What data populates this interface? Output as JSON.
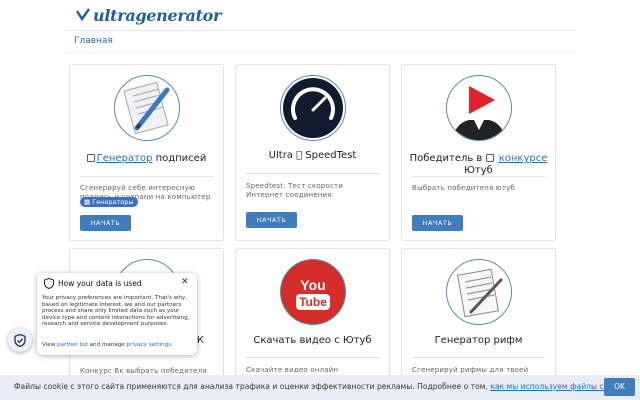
{
  "header": {
    "logo_text": "ultragenerator",
    "breadcrumb": "Главная"
  },
  "cards": [
    {
      "title_link": "Генератор",
      "title_rest": " подписей",
      "desc": "Сгенерируй себе интересную подпись и сохрани на компьютер",
      "tag": "Генераторы",
      "button": "НАЧАТЬ",
      "icon": "pen-paper-icon"
    },
    {
      "title": "Ultra ⃞ SpeedTest",
      "desc": "Speedtest: Тест скорости Интернет соединения",
      "button": "НАЧАТЬ",
      "icon": "speedometer-icon"
    },
    {
      "title_pre": "Победитель в ",
      "title_link": "конкурсе",
      "title_post": "Ютуб",
      "desc": "Выбрать победителя ютуб",
      "button": "НАЧАТЬ",
      "icon": "winner-play-icon"
    },
    {
      "title_fragment": "ВК",
      "desc": "Конкурс Вк выбрать победителя",
      "icon": "vk-contest-icon"
    },
    {
      "title": "Скачать видео с Ютуб",
      "desc": "Скачайте видео онлайн",
      "icon": "youtube-logo-icon",
      "logo_top": "You",
      "logo_bottom": "Tube"
    },
    {
      "title": "Генератор рифм",
      "desc": "Сгенерируй рифмы для твоей",
      "icon": "rhyme-paper-icon"
    }
  ],
  "privacy": {
    "title": "How your data is used",
    "body": "Your privacy preferences are important. That's why, based on legitimate interest, we and our partners process and share only limited data such as your device type and content interactions for advertising, research and service development purposes.",
    "view": "View",
    "partner_link": "partner list",
    "and_manage": "and manage",
    "settings_link": "privacy settings."
  },
  "cookie": {
    "text": "Файлы cookie с этого сайта применяются для анализа трафика и оценки эффективности рекламы. Подробнее о том,",
    "link": "как мы используем файлы cookie...",
    "ok": "OK"
  }
}
